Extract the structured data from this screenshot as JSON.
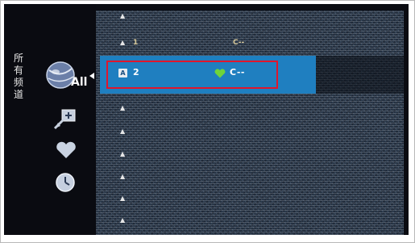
{
  "sidebar": {
    "title_chars": [
      "所",
      "有",
      "频",
      "道"
    ],
    "all_label": "All",
    "icons": [
      "globe-icon",
      "add-channel-icon",
      "heart-icon",
      "clock-icon"
    ]
  },
  "channel_list": {
    "selected": {
      "number": "2",
      "badge": "A",
      "name": "C--",
      "favorite_color": "#6fd43a"
    },
    "faint_row": {
      "number": "1",
      "name": "C--"
    }
  },
  "colors": {
    "highlight_bar": "#1f7fc0",
    "red_box": "#e0162c"
  }
}
